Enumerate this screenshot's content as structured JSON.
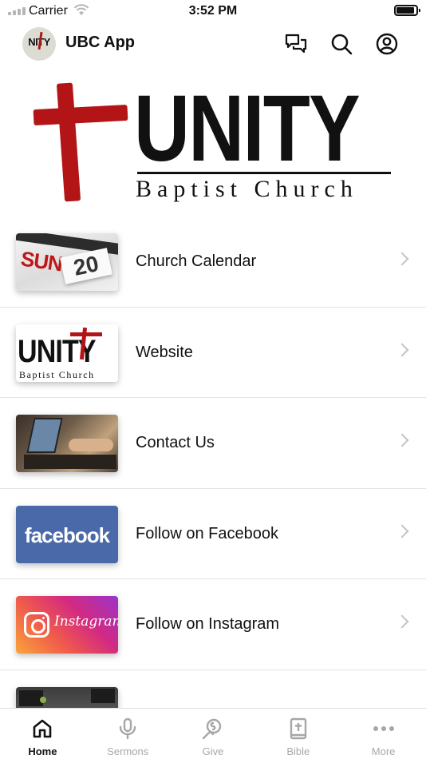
{
  "status_bar": {
    "carrier": "Carrier",
    "time": "3:52 PM"
  },
  "header": {
    "avatar_text": "NITY",
    "title": "UBC App",
    "icons": [
      "chat-icon",
      "search-icon",
      "profile-icon"
    ]
  },
  "hero": {
    "title": "UNITY",
    "subtitle": "Baptist Church",
    "accent_color": "#b31517"
  },
  "menu": {
    "items": [
      {
        "label": "Church Calendar",
        "thumb": "calendar-thumbnail",
        "thumb_text": "20",
        "thumb_red_text": "SUN"
      },
      {
        "label": "Website",
        "thumb": "unity-logo-thumbnail",
        "thumb_text": "UNITY",
        "thumb_sub": "Baptist Church"
      },
      {
        "label": "Contact Us",
        "thumb": "laptop-typing-thumbnail"
      },
      {
        "label": "Follow on Facebook",
        "thumb": "facebook-thumbnail",
        "thumb_text": "facebook"
      },
      {
        "label": "Follow on Instagram",
        "thumb": "instagram-thumbnail",
        "thumb_text": "Instagram"
      },
      {
        "label": "",
        "thumb": "video-thumbnail"
      }
    ]
  },
  "tabs": [
    {
      "label": "Home",
      "icon": "home-icon",
      "active": true
    },
    {
      "label": "Sermons",
      "icon": "microphone-icon",
      "active": false
    },
    {
      "label": "Give",
      "icon": "give-icon",
      "active": false
    },
    {
      "label": "Bible",
      "icon": "bible-icon",
      "active": false
    },
    {
      "label": "More",
      "icon": "more-dots-icon",
      "active": false
    }
  ],
  "colors": {
    "facebook": "#4a69a8",
    "tab_active": "#111111",
    "tab_inactive": "#a7a7a7"
  }
}
